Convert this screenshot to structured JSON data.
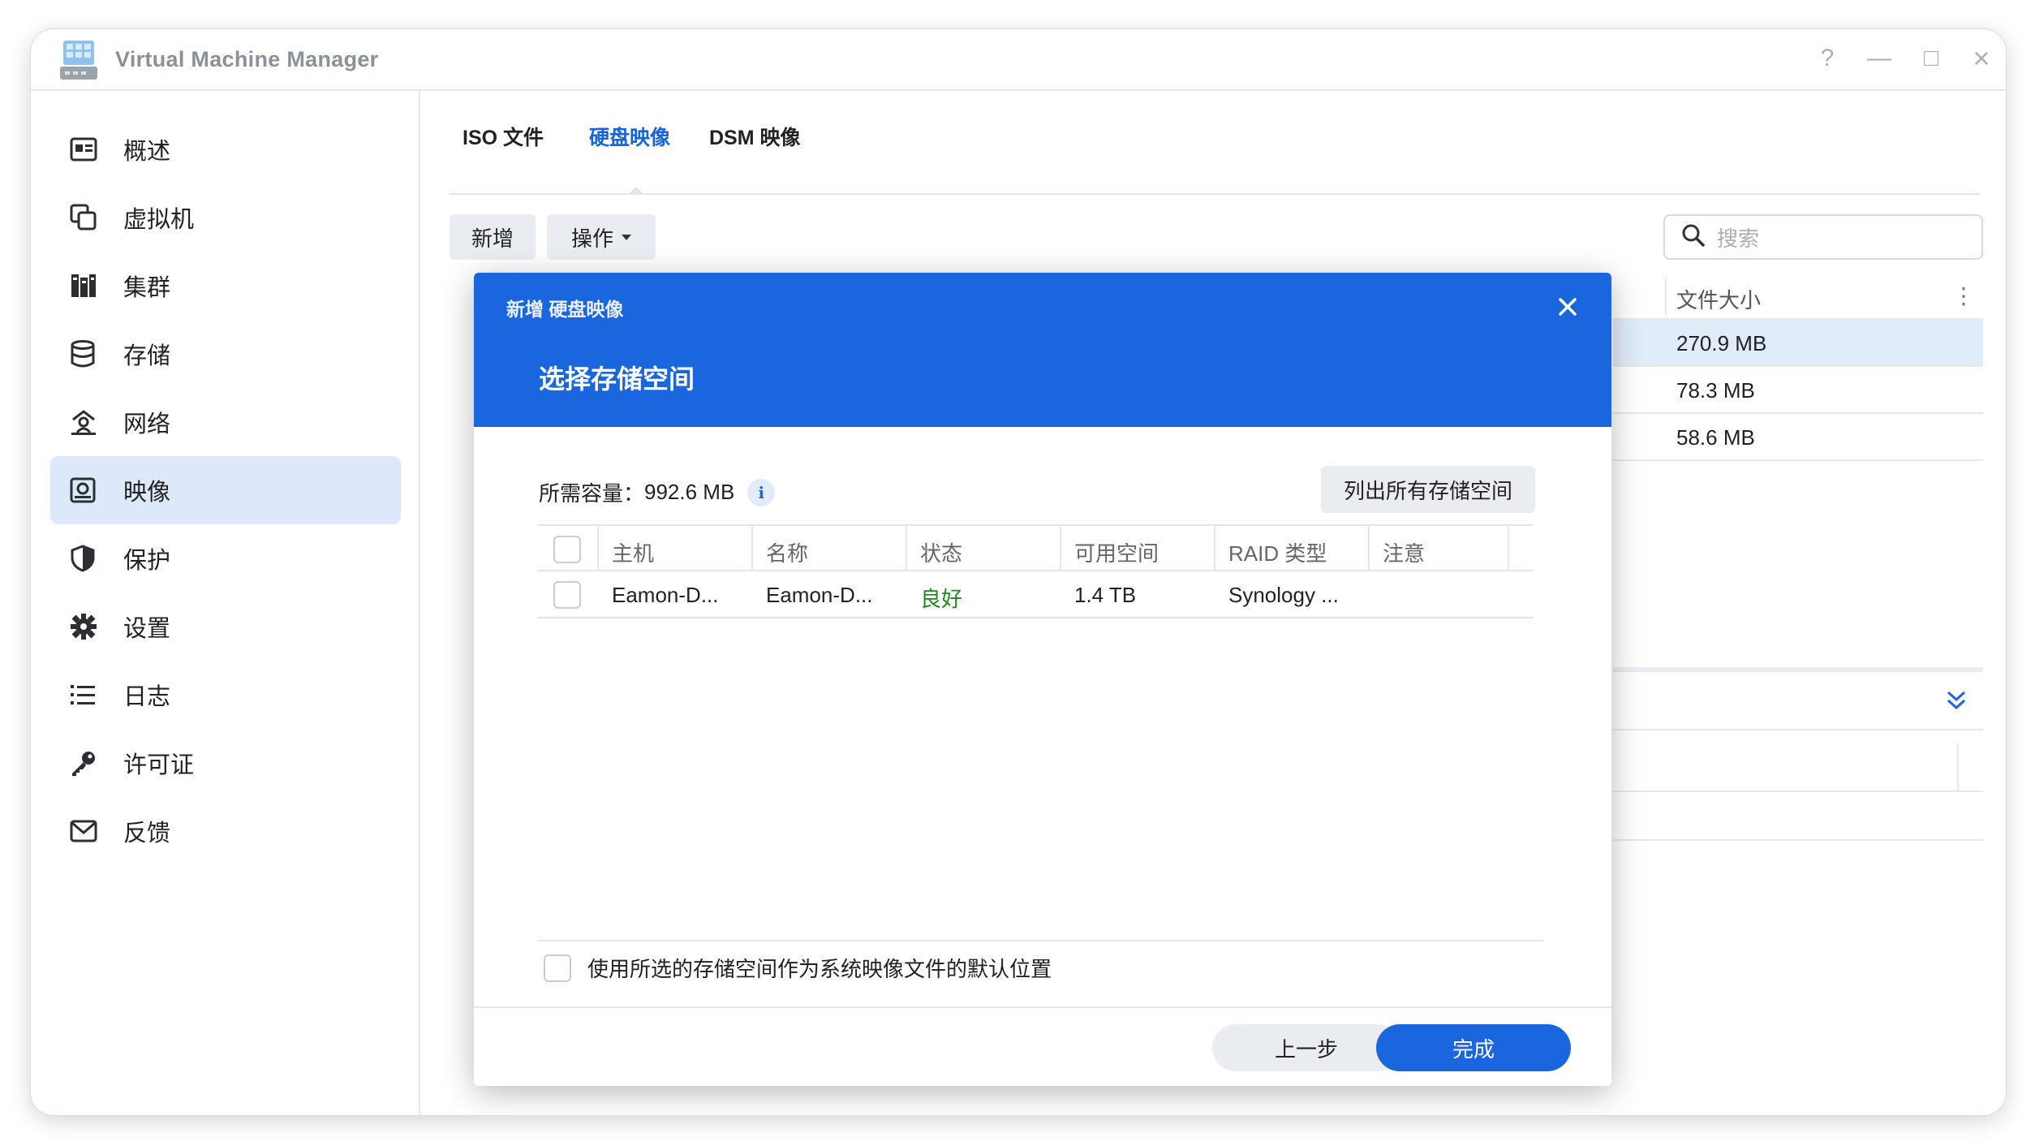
{
  "window": {
    "title": "Virtual Machine Manager",
    "controls": [
      "?",
      "—",
      "□",
      "×"
    ]
  },
  "sidebar": {
    "items": [
      {
        "label": "概述",
        "icon": "overview-icon",
        "active": false
      },
      {
        "label": "虚拟机",
        "icon": "virtual-machine-icon",
        "active": false
      },
      {
        "label": "集群",
        "icon": "cluster-icon",
        "active": false
      },
      {
        "label": "存储",
        "icon": "storage-icon",
        "active": false
      },
      {
        "label": "网络",
        "icon": "network-icon",
        "active": false
      },
      {
        "label": "映像",
        "icon": "image-icon",
        "active": true
      },
      {
        "label": "保护",
        "icon": "shield-icon",
        "active": false
      },
      {
        "label": "设置",
        "icon": "gear-icon",
        "active": false
      },
      {
        "label": "日志",
        "icon": "log-list-icon",
        "active": false
      },
      {
        "label": "许可证",
        "icon": "key-icon",
        "active": false
      },
      {
        "label": "反馈",
        "icon": "mail-icon",
        "active": false
      }
    ]
  },
  "main": {
    "tabs": [
      {
        "label": "ISO 文件",
        "active": false
      },
      {
        "label": "硬盘映像",
        "active": true
      },
      {
        "label": "DSM 映像",
        "active": false
      }
    ],
    "toolbar": {
      "add_label": "新增",
      "action_label": "操作"
    },
    "search": {
      "placeholder": "搜索"
    },
    "background_table": {
      "column": "文件大小",
      "rows": [
        "270.9 MB",
        "78.3 MB",
        "58.6 MB"
      ]
    }
  },
  "dialog": {
    "small_title": "新增 硬盘映像",
    "title": "选择存储空间",
    "required_label": "所需容量：",
    "required_value": "992.6 MB",
    "info_glyph": "i",
    "list_all_button": "列出所有存储空间",
    "table": {
      "headers": [
        "主机",
        "名称",
        "状态",
        "可用空间",
        "RAID 类型",
        "注意"
      ],
      "rows": [
        {
          "host": "Eamon-D...",
          "name": "Eamon-D...",
          "status": "良好",
          "free": "1.4 TB",
          "raid": "Synology ...",
          "note": ""
        }
      ]
    },
    "default_option_label": "使用所选的存储空间作为系统映像文件的默认位置",
    "back_button": "上一步",
    "done_button": "完成"
  },
  "colors": {
    "accent": "#1a66df",
    "active_nav": "#dde9fa",
    "status_good": "#1a8a1a"
  }
}
